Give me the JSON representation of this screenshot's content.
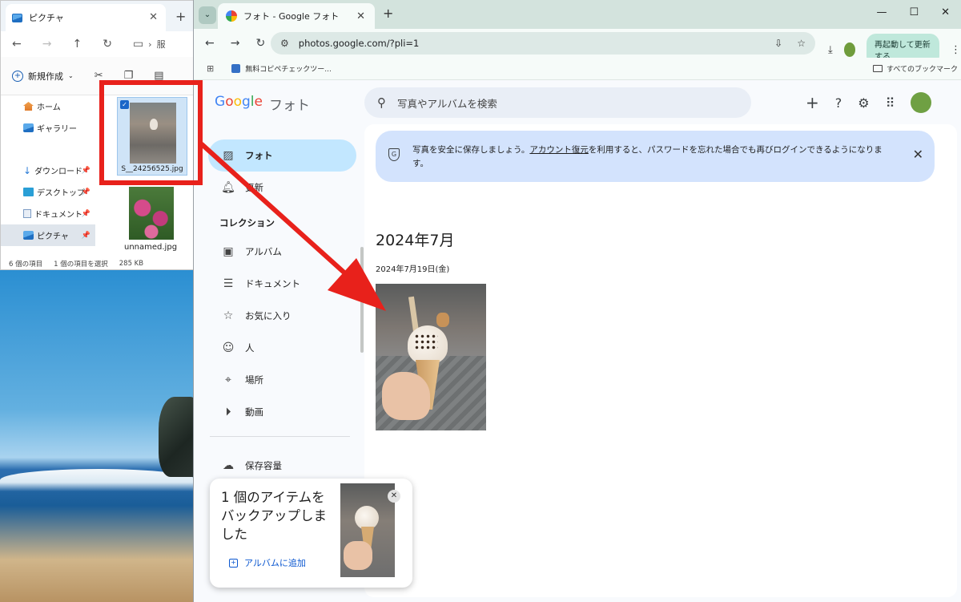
{
  "explorer": {
    "tab_title": "ピクチャ",
    "path_label": "服",
    "new_button": "新規作成",
    "sidebar": [
      {
        "label": "ホーム",
        "icon": "home-icon"
      },
      {
        "label": "ギャラリー",
        "icon": "gallery-icon"
      },
      {
        "label": "ダウンロード",
        "icon": "download-icon",
        "pinned": true
      },
      {
        "label": "デスクトップ",
        "icon": "desktop-icon",
        "pinned": true
      },
      {
        "label": "ドキュメント",
        "icon": "document-icon",
        "pinned": true
      },
      {
        "label": "ピクチャ",
        "icon": "pictures-icon",
        "pinned": true,
        "selected": true
      }
    ],
    "files": [
      {
        "name": "S__24256525.jpg",
        "selected": true
      },
      {
        "name": "unnamed.jpg",
        "selected": false
      }
    ],
    "status": {
      "count": "6 個の項目",
      "selected": "1 個の項目を選択",
      "size": "285 KB"
    }
  },
  "chrome": {
    "tab_title": "フォト - Google フォト",
    "url": "photos.google.com/?pli=1",
    "relaunch_label": "再起動して更新する",
    "bookmark_item": "無料コピペチェックツー...",
    "all_bookmarks": "すべてのブックマーク"
  },
  "photos": {
    "logo": {
      "g1": "G",
      "g2": "o",
      "g3": "o",
      "g4": "g",
      "g5": "l",
      "g6": "e",
      "product": "フォト"
    },
    "search_placeholder": "写真やアルバムを検索",
    "nav": {
      "photos": "フォト",
      "updates": "更新",
      "collections_heading": "コレクション",
      "albums": "アルバム",
      "documents": "ドキュメント",
      "favorites": "お気に入り",
      "people": "人",
      "places": "場所",
      "videos": "動画",
      "storage": "保存容量"
    },
    "banner": {
      "text_before": "写真を安全に保存しましょう。",
      "link": "アカウント復元",
      "text_after": "を利用すると、パスワードを忘れた場合でも再びログインできるようになります。"
    },
    "month_heading": "2024年7月",
    "date_label": "2024年7月19日(金)",
    "toast": {
      "message": "1 個のアイテムをバックアップしました",
      "action": "アルバムに追加"
    }
  },
  "colors": {
    "annotation_red": "#e8211b",
    "nav_active_bg": "#c2e7ff",
    "banner_bg": "#d3e3fd",
    "link_blue": "#0b57d0"
  }
}
